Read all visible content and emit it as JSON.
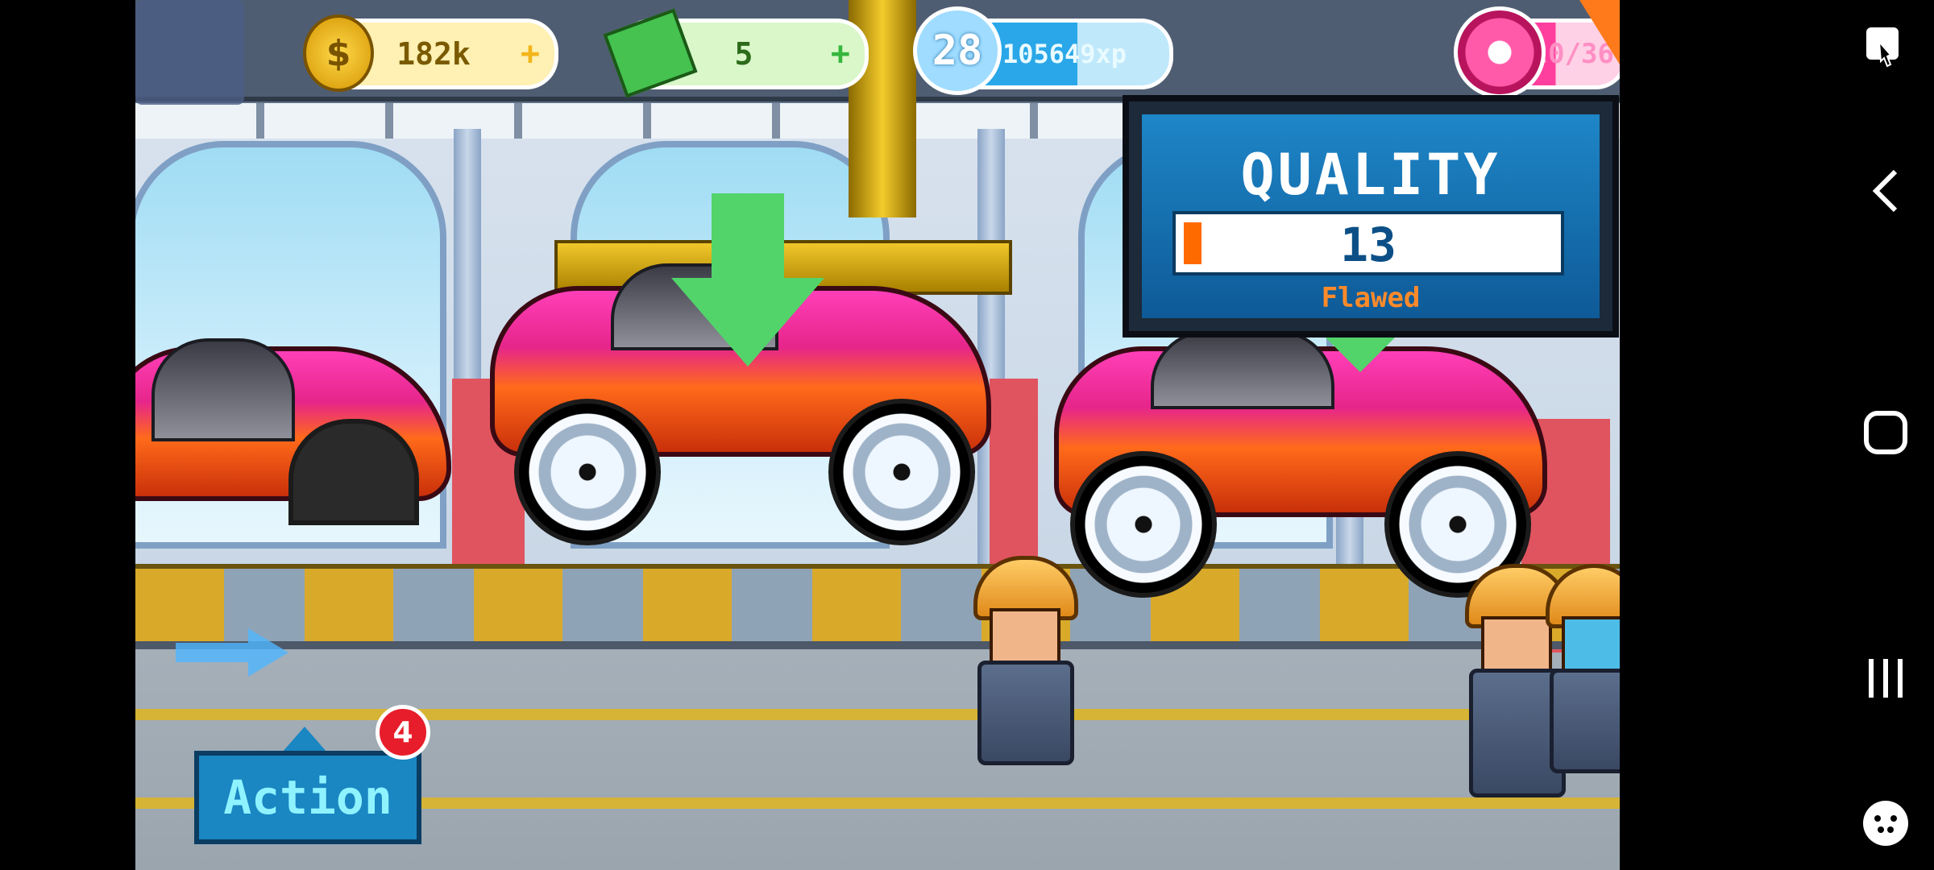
{
  "hud": {
    "coins": "182k",
    "cash": "5",
    "level": "28",
    "xp": "105649xp",
    "donuts": "20/36",
    "coin_symbol": "$",
    "plus": "+"
  },
  "quality": {
    "title": "QUALITY",
    "value": "13",
    "label": "Flawed",
    "fill_percent": 13
  },
  "action": {
    "label": "Action",
    "badge": "4"
  },
  "colors": {
    "coin": "#f7c531",
    "cash": "#45c24f",
    "xp": "#2aa7e8",
    "donut": "#ff3f9e",
    "quality_fill": "#ff6a00",
    "action_bg": "#1a86c2"
  },
  "icons": {
    "nav_top": "screenshot-edit-icon",
    "nav_back": "back-chevron-icon",
    "nav_home": "home-square-icon",
    "nav_recents": "recents-lines-icon",
    "nav_game": "game-tools-icon",
    "wrench": "wrench-icon"
  }
}
